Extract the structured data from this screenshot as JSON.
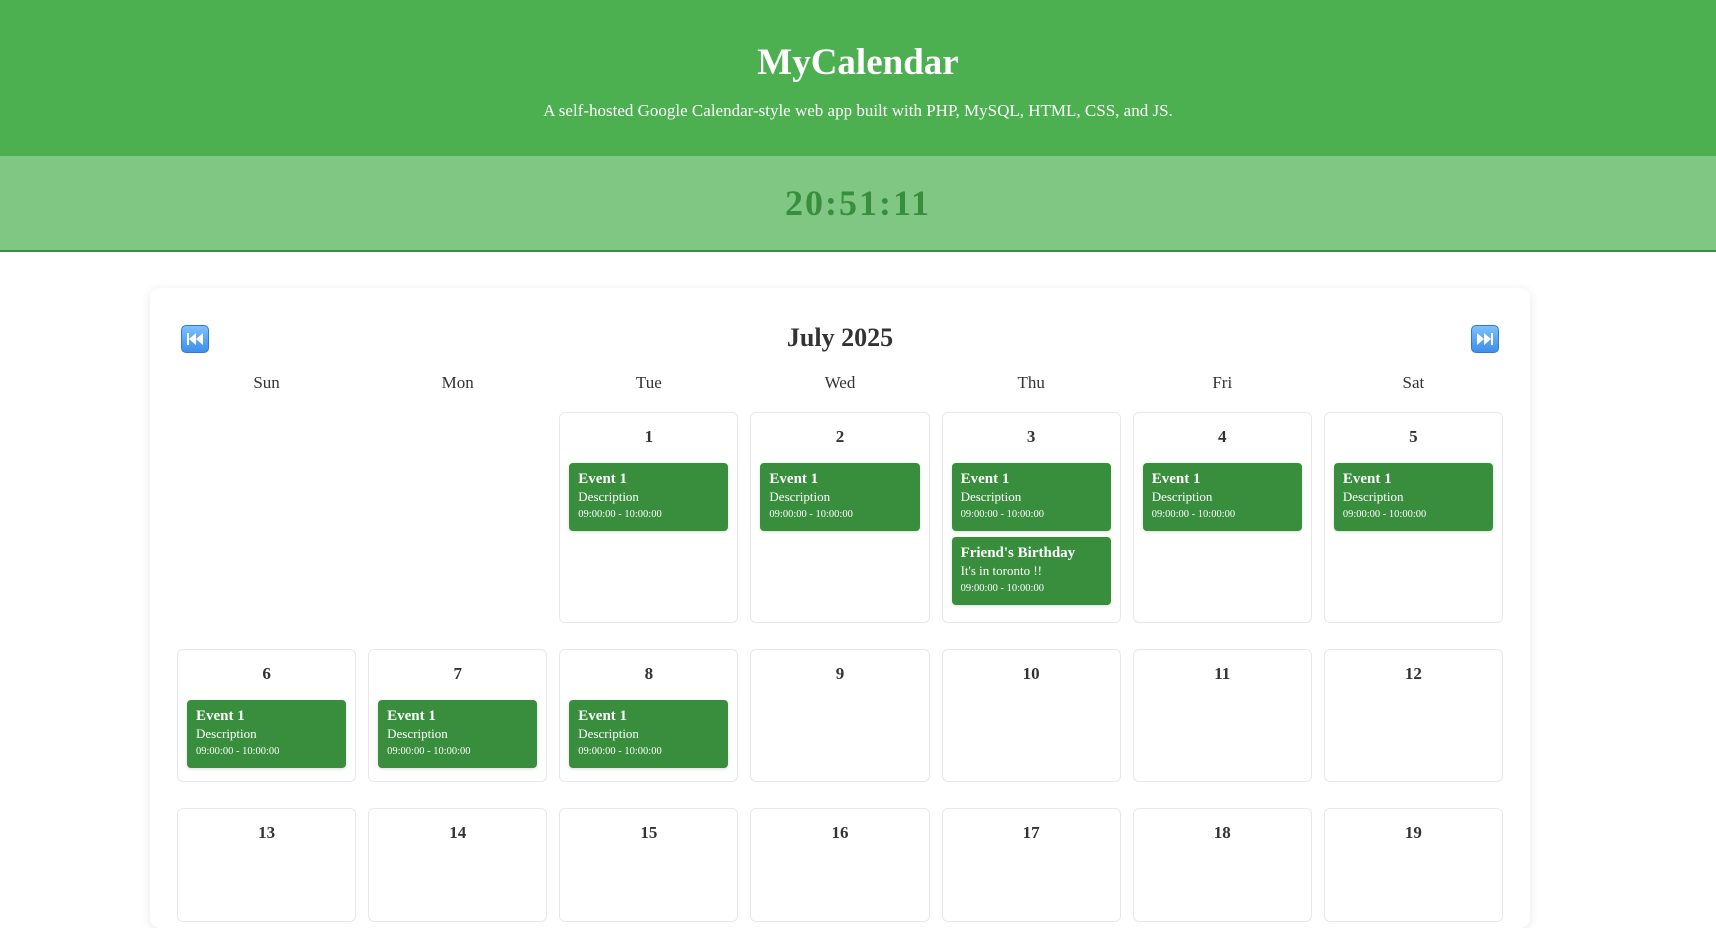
{
  "header": {
    "title": "MyCalendar",
    "subtitle": "A self-hosted Google Calendar-style web app built with PHP, MySQL, HTML, CSS, and JS."
  },
  "clock": "20:51:11",
  "calendar": {
    "month_label": "July 2025",
    "prev_icon": "rewind-icon",
    "next_icon": "fast-forward-icon",
    "weekdays": [
      "Sun",
      "Mon",
      "Tue",
      "Wed",
      "Thu",
      "Fri",
      "Sat"
    ],
    "weeks": [
      [
        {
          "day": "",
          "events": []
        },
        {
          "day": "",
          "events": []
        },
        {
          "day": "1",
          "events": [
            {
              "title": "Event 1",
              "desc": "Description",
              "time": "09:00:00 - 10:00:00"
            }
          ]
        },
        {
          "day": "2",
          "events": [
            {
              "title": "Event 1",
              "desc": "Description",
              "time": "09:00:00 - 10:00:00"
            }
          ]
        },
        {
          "day": "3",
          "events": [
            {
              "title": "Event 1",
              "desc": "Description",
              "time": "09:00:00 - 10:00:00"
            },
            {
              "title": "Friend's Birthday",
              "desc": "It's in toronto !!",
              "time": "09:00:00 - 10:00:00"
            }
          ]
        },
        {
          "day": "4",
          "events": [
            {
              "title": "Event 1",
              "desc": "Description",
              "time": "09:00:00 - 10:00:00"
            }
          ]
        },
        {
          "day": "5",
          "events": [
            {
              "title": "Event 1",
              "desc": "Description",
              "time": "09:00:00 - 10:00:00"
            }
          ]
        }
      ],
      [
        {
          "day": "6",
          "events": [
            {
              "title": "Event 1",
              "desc": "Description",
              "time": "09:00:00 - 10:00:00"
            }
          ]
        },
        {
          "day": "7",
          "events": [
            {
              "title": "Event 1",
              "desc": "Description",
              "time": "09:00:00 - 10:00:00"
            }
          ]
        },
        {
          "day": "8",
          "events": [
            {
              "title": "Event 1",
              "desc": "Description",
              "time": "09:00:00 - 10:00:00"
            }
          ]
        },
        {
          "day": "9",
          "events": []
        },
        {
          "day": "10",
          "events": []
        },
        {
          "day": "11",
          "events": []
        },
        {
          "day": "12",
          "events": []
        }
      ],
      [
        {
          "day": "13",
          "events": []
        },
        {
          "day": "14",
          "events": []
        },
        {
          "day": "15",
          "events": []
        },
        {
          "day": "16",
          "events": []
        },
        {
          "day": "17",
          "events": []
        },
        {
          "day": "18",
          "events": []
        },
        {
          "day": "19",
          "events": []
        }
      ]
    ]
  },
  "colors": {
    "header_bg": "#4caf50",
    "clock_bg": "#81c784",
    "clock_text": "#388e3c",
    "event_bg": "#388e3c",
    "nav_button": "#3d8fe8"
  }
}
